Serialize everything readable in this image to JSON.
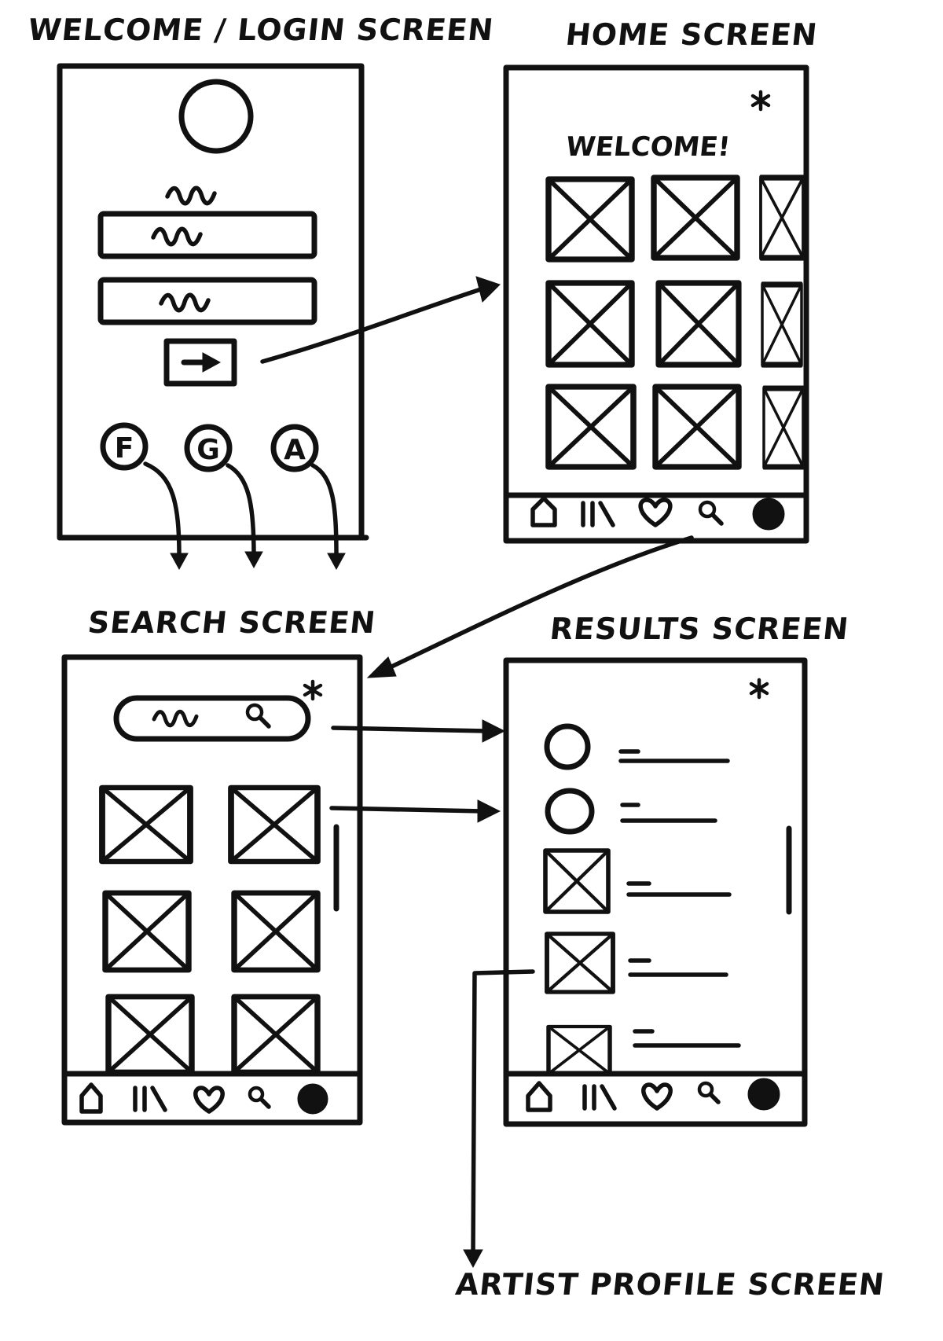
{
  "screens": {
    "welcome": {
      "title": "WELCOME / LOGIN SCREEN",
      "social_buttons": [
        "F",
        "G",
        "A"
      ]
    },
    "home": {
      "title": "HOME SCREEN",
      "greeting": "WELCOME!"
    },
    "search": {
      "title": "SEARCH SCREEN"
    },
    "results": {
      "title": "RESULTS SCREEN"
    },
    "artist_profile": {
      "title": "ARTIST PROFILE SCREEN"
    }
  },
  "tab_bar": {
    "icons": [
      "home-icon",
      "library-icon",
      "heart-icon",
      "search-icon",
      "profile-icon"
    ]
  },
  "ink_color": "#111111",
  "background_color": "#ffffff"
}
